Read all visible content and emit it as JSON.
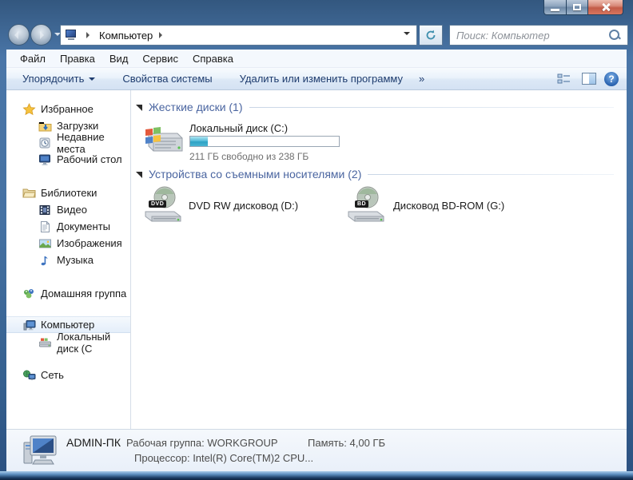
{
  "titlebar": {
    "controls": {
      "minimize": "minimize",
      "maximize": "maximize",
      "close": "close"
    }
  },
  "navbar": {
    "breadcrumb": {
      "item": "Компьютер"
    },
    "search": {
      "placeholder": "Поиск: Компьютер"
    }
  },
  "menubar": {
    "items": [
      {
        "label": "Файл"
      },
      {
        "label": "Правка"
      },
      {
        "label": "Вид"
      },
      {
        "label": "Сервис"
      },
      {
        "label": "Справка"
      }
    ]
  },
  "toolbar": {
    "organize": "Упорядочить",
    "system_properties": "Свойства системы",
    "uninstall": "Удалить или изменить программу",
    "overflow": "»"
  },
  "sidebar": {
    "groups": [
      {
        "label": "Избранное",
        "icon": "favorites-star",
        "children": [
          {
            "label": "Загрузки",
            "icon": "downloads-folder"
          },
          {
            "label": "Недавние места",
            "icon": "recent-places"
          },
          {
            "label": "Рабочий стол",
            "icon": "desktop"
          }
        ]
      },
      {
        "label": "Библиотеки",
        "icon": "libraries-folder",
        "children": [
          {
            "label": "Видео",
            "icon": "video-filmstrip"
          },
          {
            "label": "Документы",
            "icon": "document"
          },
          {
            "label": "Изображения",
            "icon": "picture"
          },
          {
            "label": "Музыка",
            "icon": "music-note"
          }
        ]
      },
      {
        "label": "Домашняя группа",
        "icon": "homegroup",
        "children": []
      },
      {
        "label": "Компьютер",
        "icon": "computer",
        "selected": true,
        "children": [
          {
            "label": "Локальный диск (C",
            "icon": "hard-disk"
          }
        ]
      },
      {
        "label": "Сеть",
        "icon": "network",
        "children": []
      }
    ]
  },
  "main": {
    "sections": [
      {
        "title": "Жесткие диски (1)",
        "items": [
          {
            "name": "Локальный диск (C:)",
            "free_text": "211 ГБ свободно из 238 ГБ",
            "used_width": "12%"
          }
        ]
      },
      {
        "title": "Устройства со съемными носителями (2)",
        "items": [
          {
            "name": "DVD RW дисковод (D:)",
            "badge": "DVD"
          },
          {
            "name": "Дисковод BD-ROM (G:)",
            "badge": "BD"
          }
        ]
      }
    ]
  },
  "statusbar": {
    "computer_name": "ADMIN-ПК",
    "workgroup_label": "Рабочая группа:",
    "workgroup_value": "WORKGROUP",
    "memory_label": "Память:",
    "memory_value": "4,00 ГБ",
    "processor_label": "Процессор:",
    "processor_value": "Intel(R) Core(TM)2 CPU..."
  },
  "icons": {
    "help_glyph": "?"
  }
}
